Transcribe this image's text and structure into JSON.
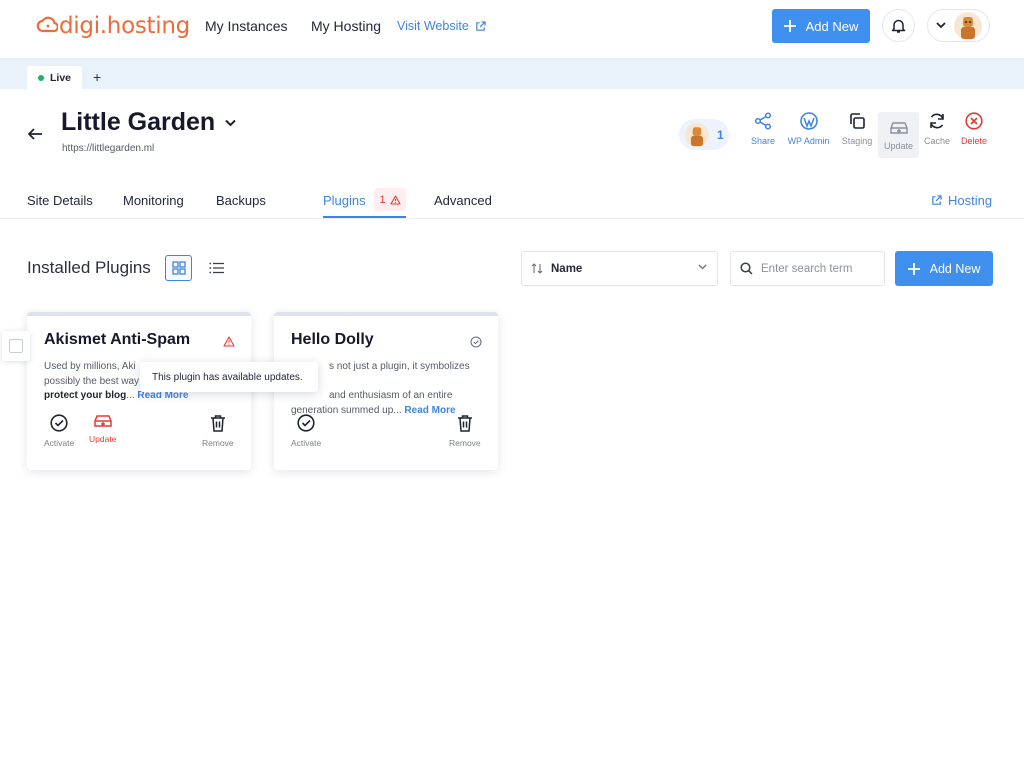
{
  "header": {
    "logo_text": "digi.hosting",
    "nav": [
      "My Instances",
      "My Hosting"
    ],
    "visit_website": "Visit Website",
    "add_new": "Add New"
  },
  "environment": {
    "active_tab": "Live",
    "add_tab": "+"
  },
  "site": {
    "title": "Little Garden",
    "url": "https://littlegarden.ml",
    "users_count": "1",
    "actions": [
      "Share",
      "WP Admin",
      "Staging",
      "Update",
      "Cache",
      "Delete"
    ]
  },
  "tabs": {
    "items": [
      "Site Details",
      "Monitoring",
      "Backups",
      "Plugins",
      "Advanced"
    ],
    "active": "Plugins",
    "plugins_badge": "1",
    "hosting": "Hosting"
  },
  "toolbar": {
    "title": "Installed Plugins",
    "sort_label": "Name",
    "search_placeholder": "Enter search term",
    "add_new": "Add New"
  },
  "plugins": [
    {
      "name": "Akismet Anti-Spam",
      "desc_start": "Used by millions, Aki",
      "desc_line2": "possibly the best way",
      "desc_bold": "protect your blog",
      "ellipsis": "...",
      "read_more": "Read More",
      "status": "warning",
      "actions": [
        "Activate",
        "Update",
        "Remove"
      ]
    },
    {
      "name": "Hello Dolly",
      "desc_line1": "s not just a plugin, it symbolizes the",
      "desc_line2": "and enthusiasm of an entire",
      "desc_line3": "generation summed up",
      "ellipsis": "...",
      "read_more": "Read More",
      "status": "ok",
      "actions": [
        "Activate",
        "Remove"
      ]
    }
  ],
  "tooltip": "This plugin has available updates.",
  "colors": {
    "brand": "#f06a3a",
    "accent": "#3f8fef",
    "link": "#3f84e0",
    "danger": "#e53935",
    "live": "#19b46a"
  }
}
